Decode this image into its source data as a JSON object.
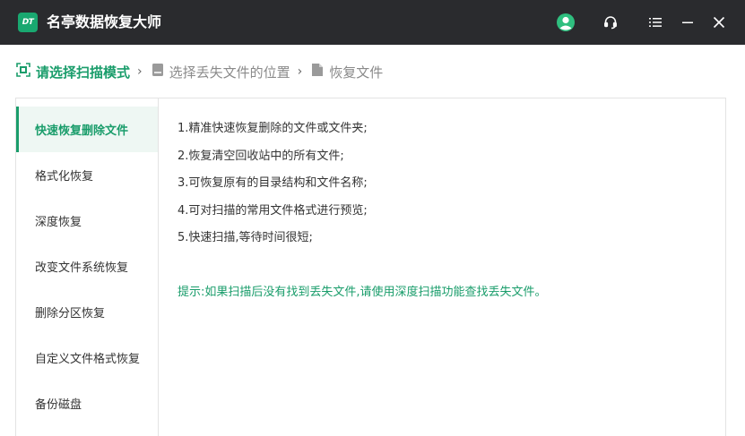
{
  "app": {
    "logo_text": "DT",
    "title": "名亭数据恢复大师"
  },
  "titlebar_icons": [
    "user-icon",
    "headset-icon",
    "menu-icon",
    "minimize-icon",
    "close-icon"
  ],
  "steps": [
    {
      "label": "请选择扫描模式",
      "active": true
    },
    {
      "label": "选择丢失文件的位置",
      "active": false
    },
    {
      "label": "恢复文件",
      "active": false
    }
  ],
  "sidebar": {
    "items": [
      {
        "label": "快速恢复删除文件",
        "active": true
      },
      {
        "label": "格式化恢复",
        "active": false
      },
      {
        "label": "深度恢复",
        "active": false
      },
      {
        "label": "改变文件系统恢复",
        "active": false
      },
      {
        "label": "删除分区恢复",
        "active": false
      },
      {
        "label": "自定义文件格式恢复",
        "active": false
      },
      {
        "label": "备份磁盘",
        "active": false
      }
    ]
  },
  "content": {
    "lines": [
      "1.精准快速恢复删除的文件或文件夹;",
      "2.恢复清空回收站中的所有文件;",
      "3.可恢复原有的目录结构和文件名称;",
      "4.可对扫描的常用文件格式进行预览;",
      "5.快速扫描,等待时间很短;"
    ],
    "tip": "提示:如果扫描后没有找到丢失文件,请使用深度扫描功能查找丢失文件。"
  },
  "colors": {
    "accent": "#1a9d6b",
    "titlebar": "#2a2b2e",
    "logo": "#19a870"
  }
}
